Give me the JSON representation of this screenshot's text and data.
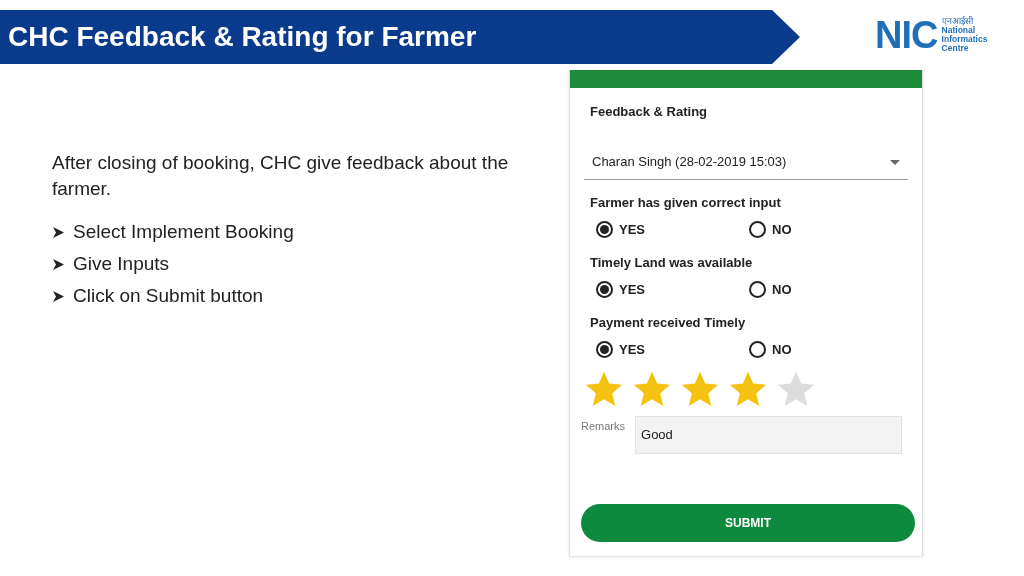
{
  "title": "CHC Feedback & Rating for Farmer",
  "logo": {
    "hindi": "एनआईसी",
    "lines": [
      "National",
      "Informatics",
      "Centre"
    ],
    "mark": "NIC"
  },
  "intro": "After closing of booking, CHC give feedback about the farmer.",
  "steps": [
    "Select Implement Booking",
    "Give Inputs",
    "Click on Submit button"
  ],
  "app": {
    "heading": "Feedback & Rating",
    "booking": "Charan Singh (28-02-2019 15:03)",
    "questions": [
      {
        "label": "Farmer has given correct input",
        "options": [
          {
            "label": "YES",
            "selected": true
          },
          {
            "label": "NO",
            "selected": false
          }
        ]
      },
      {
        "label": "Timely Land was available",
        "options": [
          {
            "label": "YES",
            "selected": true
          },
          {
            "label": "NO",
            "selected": false
          }
        ]
      },
      {
        "label": "Payment received Timely",
        "options": [
          {
            "label": "YES",
            "selected": true
          },
          {
            "label": "NO",
            "selected": false
          }
        ]
      }
    ],
    "rating": {
      "stars": 4
    },
    "remarks": {
      "label": "Remarks",
      "value": "Good"
    },
    "submit": "SUBMIT"
  }
}
